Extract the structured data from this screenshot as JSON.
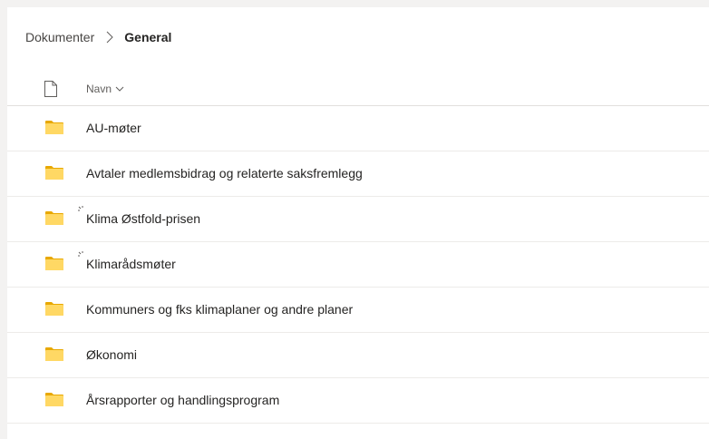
{
  "breadcrumb": {
    "parent": "Dokumenter",
    "current": "General"
  },
  "header": {
    "name_column": "Navn"
  },
  "icons": {
    "file_type": "document-icon",
    "sort": "chevron-down-icon",
    "folder": "folder-icon",
    "sync": "sync-spinner-icon"
  },
  "colors": {
    "folder": "#ffd864",
    "folder_tab": "#e8a800"
  },
  "folders": [
    {
      "name": "AU-møter",
      "syncing": false
    },
    {
      "name": "Avtaler medlemsbidrag og relaterte saksfremlegg",
      "syncing": false
    },
    {
      "name": "Klima Østfold-prisen",
      "syncing": true
    },
    {
      "name": "Klimarådsmøter",
      "syncing": true
    },
    {
      "name": "Kommuners og fks klimaplaner og andre planer",
      "syncing": false
    },
    {
      "name": "Økonomi",
      "syncing": false
    },
    {
      "name": "Årsrapporter og handlingsprogram",
      "syncing": false
    }
  ]
}
